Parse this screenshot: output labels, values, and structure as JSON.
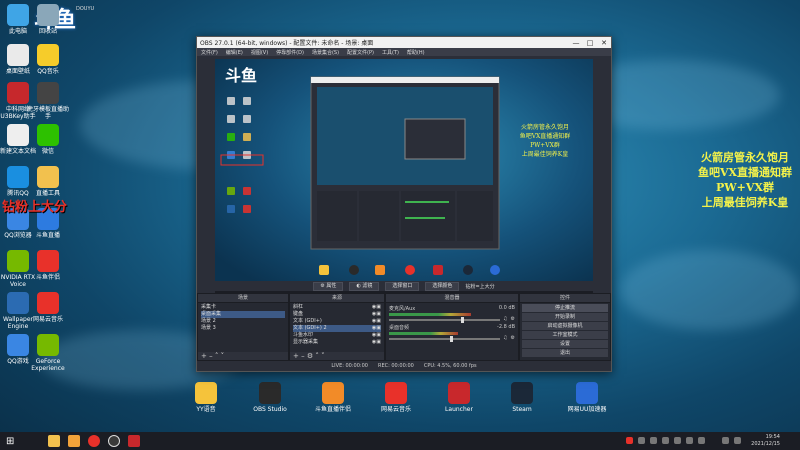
{
  "desktop": {
    "left_icons": [
      {
        "label": "此电脑",
        "icon": "computer-icon",
        "color": "#3fa5e6"
      },
      {
        "label": "回收站",
        "icon": "trash-icon",
        "color": "#8aa7b9"
      },
      {
        "label": "桌面壁纸",
        "icon": "wallpaper-icon",
        "color": "#eaeaea"
      },
      {
        "label": "QQ音乐",
        "icon": "qqmusic-icon",
        "color": "#f6cc2a"
      },
      {
        "label": "中科网络 U3BKey助手",
        "icon": "key-icon",
        "color": "#c6282c"
      },
      {
        "label": "虎牙模板直播助手",
        "icon": "tiger-icon",
        "color": "#444"
      },
      {
        "label": "新建文本文档",
        "icon": "document-icon",
        "color": "#eeeeee"
      },
      {
        "label": "微信",
        "icon": "wechat-icon",
        "color": "#2dc100"
      },
      {
        "label": "腾讯QQ",
        "icon": "qq-icon",
        "color": "#1a8fe0"
      },
      {
        "label": "直播工具",
        "icon": "folder-icon",
        "color": "#f2c14e"
      },
      {
        "label": "QQ浏览器",
        "icon": "qqbrowser-icon",
        "color": "#3a86e3"
      },
      {
        "label": "斗鱼直播",
        "icon": "douyu-icon",
        "color": "#2d7be0"
      },
      {
        "label": "NVIDIA RTX Voice",
        "icon": "nvidia-icon",
        "color": "#76b900"
      },
      {
        "label": "斗鱼伴侣",
        "icon": "companion-icon",
        "color": "#e8312a"
      },
      {
        "label": "Wallpaper Engine",
        "icon": "wallpaper-engine-icon",
        "color": "#2b6bb2"
      },
      {
        "label": "网易云音乐",
        "icon": "netease-icon",
        "color": "#e8312a"
      },
      {
        "label": "QQ游戏",
        "icon": "qqgame-icon",
        "color": "#3a86e3"
      },
      {
        "label": "GeForce Experience",
        "icon": "geforce-icon",
        "color": "#76b900"
      }
    ],
    "bottom_icons": [
      {
        "label": "YY语音",
        "icon": "yy-icon",
        "color": "#f5c33b"
      },
      {
        "label": "OBS Studio",
        "icon": "obs-icon",
        "color": "#2a2a2a"
      },
      {
        "label": "斗鱼直播伴侣",
        "icon": "douyu-companion-icon",
        "color": "#f28b28"
      },
      {
        "label": "网易云音乐",
        "icon": "netease-icon",
        "color": "#e8312a"
      },
      {
        "label": "Launcher",
        "icon": "launcher-icon",
        "color": "#c8282c"
      },
      {
        "label": "Steam",
        "icon": "steam-icon",
        "color": "#1b2838"
      },
      {
        "label": "网易UU加速器",
        "icon": "uu-icon",
        "color": "#2b6bd6"
      }
    ],
    "logo_text": "斗鱼",
    "logo_subtext": "DOUYU",
    "overlay_text": "钻粉上大分",
    "promo_lines": [
      "火箭房管永久饱月",
      "鱼吧VX直播通知群",
      "PW+VX群",
      "上周最佳饲养K皇"
    ]
  },
  "obs": {
    "title": "OBS 27.0.1 (64-bit, windows) - 配置文件: 未命名 - 场景: 桌面",
    "menu": [
      "文件(F)",
      "编辑(E)",
      "视图(V)",
      "停靠部件(D)",
      "场景集合(S)",
      "配置文件(P)",
      "工具(T)",
      "帮助(H)"
    ],
    "source_toolbar": {
      "props_label": "属性",
      "filters_label": "滤镜",
      "select_window_label": "选择窗口",
      "select_color_label": "选择颜色",
      "current_text": "钻粉=上大分"
    },
    "scenes": {
      "title": "场景",
      "items": [
        "采集卡",
        "桌面采集",
        "场景 2",
        "场景 3"
      ],
      "selected_index": 1
    },
    "sources": {
      "title": "来源",
      "items": [
        "斜杠",
        "键盘",
        "文本 (GDI+)",
        "文本 (GDI+) 2",
        "斗鱼水印",
        "显示器采集"
      ],
      "selected_index": 3
    },
    "mixer": {
      "title": "混音器",
      "channels": [
        {
          "name": "麦克风/Aux",
          "db": "0.0 dB",
          "level": 0.65
        },
        {
          "name": "桌面音频",
          "db": "-2.8 dB",
          "level": 0.55
        }
      ]
    },
    "controls": {
      "title": "控件",
      "buttons": [
        "停止推流",
        "开始录制",
        "启动虚拟摄像机",
        "工作室模式",
        "设置",
        "退出"
      ]
    },
    "status": {
      "live": "LIVE: 00:00:00",
      "rec": "REC: 00:00:00",
      "cpu": "CPU: 4.5%, 60.00 fps"
    }
  },
  "taskbar": {
    "time": "19:54",
    "date": "2021/12/15"
  }
}
